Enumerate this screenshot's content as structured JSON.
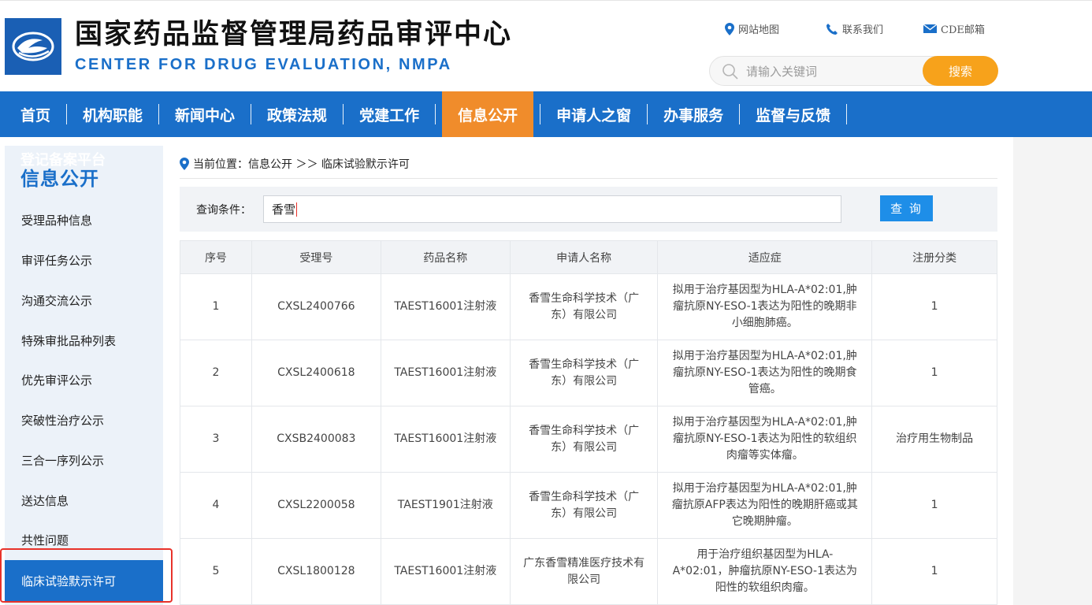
{
  "header": {
    "title": "国家药品监督管理局药品审评中心",
    "subtitle": "CENTER FOR DRUG EVALUATION, NMPA",
    "links": [
      {
        "label": "网站地图",
        "icon": "location-pin-icon"
      },
      {
        "label": "联系我们",
        "icon": "phone-icon"
      },
      {
        "label": "CDE邮箱",
        "icon": "mail-icon"
      }
    ],
    "search": {
      "placeholder": "请输入关键词",
      "button": "搜索"
    }
  },
  "nav": {
    "items": [
      "首页",
      "机构职能",
      "新闻中心",
      "政策法规",
      "党建工作",
      "信息公开",
      "申请人之窗",
      "办事服务",
      "监督与反馈"
    ],
    "active": "信息公开"
  },
  "sidebar": {
    "ghost_text": "登记备案平台",
    "title": "信息公开",
    "items": [
      "受理品种信息",
      "审评任务公示",
      "沟通交流公示",
      "特殊审批品种列表",
      "优先审评公示",
      "突破性治疗公示",
      "三合一序列公示",
      "送达信息",
      "共性问题",
      "临床试验默示许可"
    ],
    "active": "临床试验默示许可"
  },
  "breadcrumb": {
    "text": "当前位置：信息公开 ＞＞ 临床试验默示许可"
  },
  "query": {
    "label": "查询条件：",
    "value": "香雪",
    "button": "查 询"
  },
  "table": {
    "headers": [
      "序号",
      "受理号",
      "药品名称",
      "申请人名称",
      "适应症",
      "注册分类"
    ],
    "rows": [
      {
        "no": "1",
        "id": "CXSL2400766",
        "drug": "TAEST16001注射液",
        "applicant": "香雪生命科学技术（广东）有限公司",
        "indication": "拟用于治疗基因型为HLA-A*02:01,肿瘤抗原NY-ESO-1表达为阳性的晚期非小细胞肺癌。",
        "category": "1"
      },
      {
        "no": "2",
        "id": "CXSL2400618",
        "drug": "TAEST16001注射液",
        "applicant": "香雪生命科学技术（广东）有限公司",
        "indication": "拟用于治疗基因型为HLA-A*02:01,肿瘤抗原NY-ESO-1表达为阳性的晚期食管癌。",
        "category": "1"
      },
      {
        "no": "3",
        "id": "CXSB2400083",
        "drug": "TAEST16001注射液",
        "applicant": "香雪生命科学技术（广东）有限公司",
        "indication": "拟用于治疗基因型为HLA-A*02:01,肿瘤抗原NY-ESO-1表达为阳性的软组织肉瘤等实体瘤。",
        "category": "治疗用生物制品"
      },
      {
        "no": "4",
        "id": "CXSL2200058",
        "drug": "TAEST1901注射液",
        "applicant": "香雪生命科学技术（广东）有限公司",
        "indication": "拟用于治疗基因型为HLA-A*02:01,肿瘤抗原AFP表达为阳性的晚期肝癌或其它晚期肿瘤。",
        "category": "1"
      },
      {
        "no": "5",
        "id": "CXSL1800128",
        "drug": "TAEST16001注射液",
        "applicant": "广东香雪精准医疗技术有限公司",
        "indication": "用于治疗组织基因型为HLA-A*02:01，肿瘤抗原NY-ESO-1表达为阳性的软组织肉瘤。",
        "category": "1"
      }
    ]
  },
  "colors": {
    "primary_blue": "#1a6fc9",
    "nav_active_orange": "#f08c2b",
    "search_button": "#f7a21b",
    "highlight_red": "#e8322a"
  }
}
